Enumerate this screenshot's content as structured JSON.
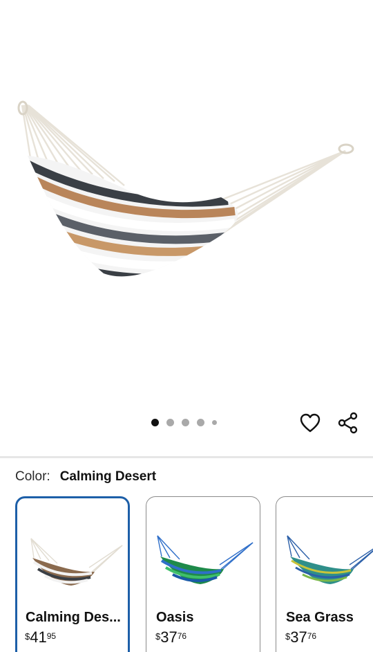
{
  "product": {
    "image_alt": "Calming Desert hammock",
    "gallery": {
      "count": 5,
      "active_index": 0
    }
  },
  "actions": {
    "favorite_icon": "heart-outline-icon",
    "share_icon": "share-icon"
  },
  "color_selector": {
    "label": "Color:",
    "selected": "Calming Desert",
    "options": [
      {
        "name": "Calming Des...",
        "currency": "$",
        "dollars": "41",
        "cents": "95",
        "selected": true,
        "colors": [
          "#8a6a4e",
          "#f2f2f2",
          "#3a3f45",
          "#b9855a"
        ]
      },
      {
        "name": "Oasis",
        "currency": "$",
        "dollars": "37",
        "cents": "76",
        "selected": false,
        "colors": [
          "#1e8a4a",
          "#2f6fc9",
          "#3fbf6a",
          "#1a5aa8"
        ]
      },
      {
        "name": "Sea Grass",
        "currency": "$",
        "dollars": "37",
        "cents": "76",
        "selected": false,
        "colors": [
          "#2f8f8a",
          "#c9c43a",
          "#2b5fa8",
          "#7bb84a"
        ]
      }
    ]
  },
  "colors": {
    "selected_border": "#1d5fa8",
    "dot_active": "#111111",
    "dot_inactive": "#a9a9a9"
  }
}
